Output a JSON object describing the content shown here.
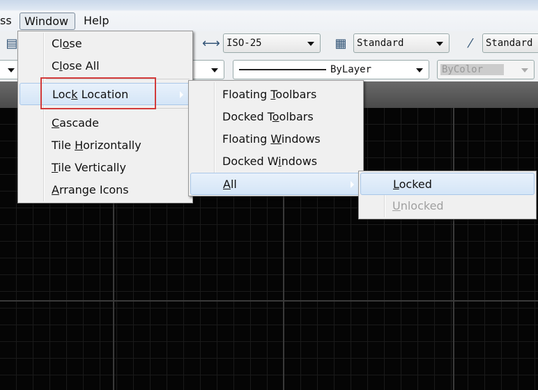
{
  "menubar": {
    "items": [
      {
        "label": "ss"
      },
      {
        "label": "Window"
      },
      {
        "label": "Help"
      }
    ]
  },
  "toolbar": {
    "dimstyle": {
      "value": "ISO-25",
      "icon": "dimension-style-icon"
    },
    "tablestyle": {
      "value": "Standard",
      "icon": "table-style-icon"
    },
    "mleaderstyle": {
      "value": "Standard",
      "icon": "multileader-style-icon"
    },
    "linetype": {
      "value": "ByLayer"
    },
    "plotstyle": {
      "value": "ByColor",
      "disabled": true
    }
  },
  "window_menu": {
    "items": [
      {
        "pre": "Cl",
        "u": "o",
        "post": "se"
      },
      {
        "pre": "C",
        "u": "l",
        "post": "ose All"
      },
      {
        "pre": "Loc",
        "u": "k",
        "post": " Location",
        "submenu": true,
        "highlighted": true
      },
      {
        "pre": "",
        "u": "C",
        "post": "ascade"
      },
      {
        "pre": "Tile ",
        "u": "H",
        "post": "orizontally"
      },
      {
        "pre": "",
        "u": "T",
        "post": "ile Vertically"
      },
      {
        "pre": "",
        "u": "A",
        "post": "rrange Icons"
      }
    ]
  },
  "lock_menu": {
    "items": [
      {
        "pre": "Floating ",
        "u": "T",
        "post": "oolbars"
      },
      {
        "pre": "Docked T",
        "u": "o",
        "post": "olbars"
      },
      {
        "pre": "Floating ",
        "u": "W",
        "post": "indows"
      },
      {
        "pre": "Docked W",
        "u": "i",
        "post": "ndows"
      },
      {
        "pre": "",
        "u": "A",
        "post": "ll",
        "submenu": true,
        "highlighted": true
      }
    ]
  },
  "all_menu": {
    "items": [
      {
        "pre": "",
        "u": "L",
        "post": "ocked",
        "highlighted": true
      },
      {
        "pre": "",
        "u": "U",
        "post": "nlocked",
        "disabled": true
      }
    ]
  },
  "colors": {
    "highlight_box": "#d23a3a",
    "canvas": "#000000"
  }
}
